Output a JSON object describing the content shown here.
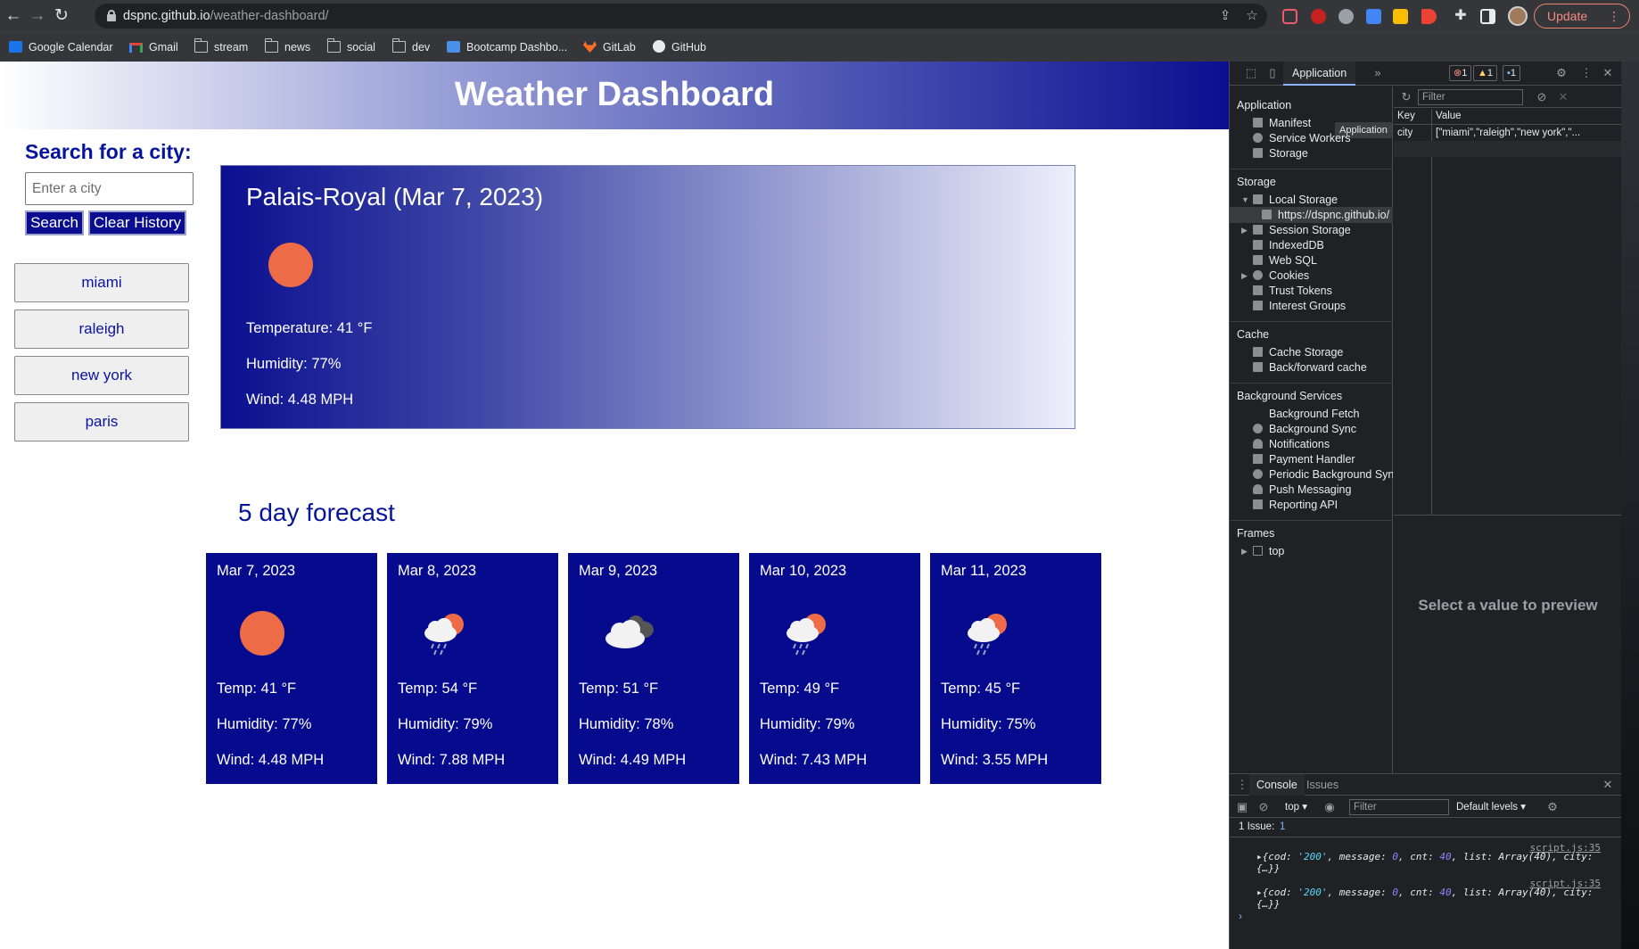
{
  "browser": {
    "url_host": "dspnc.github.io",
    "url_path": "/weather-dashboard/",
    "update_label": "Update",
    "bookmarks": [
      "Google Calendar",
      "Gmail",
      "stream",
      "news",
      "social",
      "dev",
      "Bootcamp Dashbo...",
      "GitLab",
      "GitHub"
    ]
  },
  "app": {
    "title": "Weather Dashboard",
    "search_title": "Search for a city:",
    "search_placeholder": "Enter a city",
    "search_button": "Search",
    "clear_button": "Clear History",
    "history": [
      "miami",
      "raleigh",
      "new york",
      "paris"
    ]
  },
  "current": {
    "heading": "Palais-Royal (Mar 7, 2023)",
    "icon": "clear-sun-icon",
    "temperature": "Temperature: 41 °F",
    "humidity": "Humidity: 77%",
    "wind": "Wind: 4.48 MPH"
  },
  "forecast_title": "5 day forecast",
  "forecast": [
    {
      "date": "Mar 7, 2023",
      "icon": "clear-sun-icon",
      "temp": "Temp: 41 °F",
      "humidity": "Humidity: 77%",
      "wind": "Wind: 4.48 MPH"
    },
    {
      "date": "Mar 8, 2023",
      "icon": "rain-sun-cloud-icon",
      "temp": "Temp: 54 °F",
      "humidity": "Humidity: 79%",
      "wind": "Wind: 7.88 MPH"
    },
    {
      "date": "Mar 9, 2023",
      "icon": "broken-clouds-icon",
      "temp": "Temp: 51 °F",
      "humidity": "Humidity: 78%",
      "wind": "Wind: 4.49 MPH"
    },
    {
      "date": "Mar 10, 2023",
      "icon": "rain-sun-cloud-icon",
      "temp": "Temp: 49 °F",
      "humidity": "Humidity: 79%",
      "wind": "Wind: 7.43 MPH"
    },
    {
      "date": "Mar 11, 2023",
      "icon": "rain-sun-cloud-icon",
      "temp": "Temp: 45 °F",
      "humidity": "Humidity: 75%",
      "wind": "Wind: 3.55 MPH"
    }
  ],
  "devtools": {
    "active_tab": "Application",
    "badges": {
      "errors": "1",
      "warnings": "1",
      "info": "1"
    },
    "tooltip": "Application",
    "sections": {
      "application": {
        "title": "Application",
        "items": [
          "Manifest",
          "Service Workers",
          "Storage"
        ]
      },
      "storage": {
        "title": "Storage",
        "items": [
          "Local Storage",
          "https://dspnc.github.io/",
          "Session Storage",
          "IndexedDB",
          "Web SQL",
          "Cookies",
          "Trust Tokens",
          "Interest Groups"
        ]
      },
      "cache": {
        "title": "Cache",
        "items": [
          "Cache Storage",
          "Back/forward cache"
        ]
      },
      "background": {
        "title": "Background Services",
        "items": [
          "Background Fetch",
          "Background Sync",
          "Notifications",
          "Payment Handler",
          "Periodic Background Sync",
          "Push Messaging",
          "Reporting API"
        ]
      },
      "frames": {
        "title": "Frames",
        "items": [
          "top"
        ]
      }
    },
    "filter_placeholder": "Filter",
    "table": {
      "key_header": "Key",
      "value_header": "Value",
      "row_key": "city",
      "row_value": "[\"miami\",\"raleigh\",\"new york\",\"..."
    },
    "preview_text": "Select a value to preview",
    "console": {
      "tabs": [
        "Console",
        "Issues"
      ],
      "context": "top",
      "filter_placeholder": "Filter",
      "levels": "Default levels",
      "issues": "1 Issue:",
      "issues_count": "1",
      "source": "script.js:35"
    }
  }
}
